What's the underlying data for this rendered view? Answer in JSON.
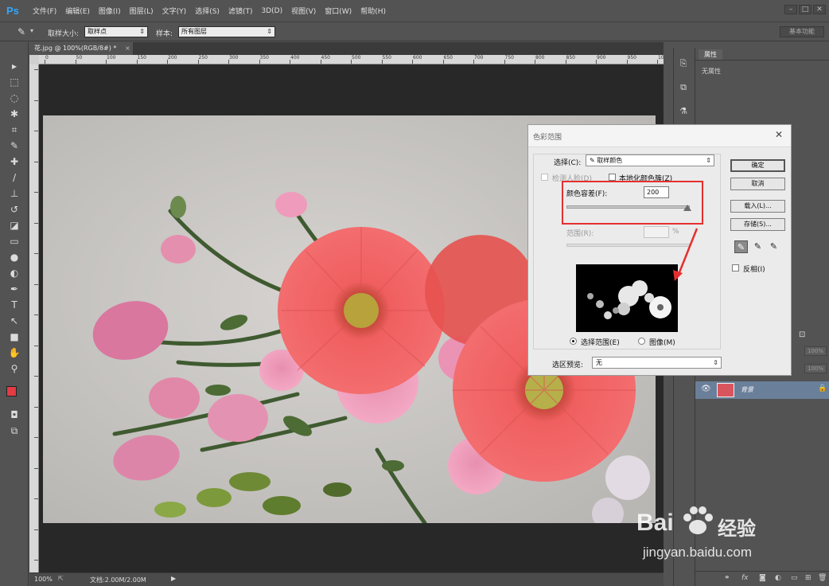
{
  "app": {
    "logo": "Ps"
  },
  "menu": [
    "文件(F)",
    "编辑(E)",
    "图像(I)",
    "图层(L)",
    "文字(Y)",
    "选择(S)",
    "滤镜(T)",
    "3D(D)",
    "视图(V)",
    "窗口(W)",
    "帮助(H)"
  ],
  "options_bar": {
    "sample_size_label": "取样大小:",
    "sample_size_value": "取样点",
    "sample_label": "样本:",
    "sample_value": "所有图层",
    "workspace": "基本功能"
  },
  "document": {
    "tab_title": "花.jpg @ 100%(RGB/8#) *",
    "ruler_ticks": [
      "0",
      "50",
      "100",
      "150",
      "200",
      "250",
      "300",
      "350",
      "400",
      "450",
      "500",
      "550",
      "600",
      "650",
      "700",
      "750",
      "800",
      "850",
      "900",
      "950",
      "1000"
    ]
  },
  "status": {
    "zoom": "100%",
    "doc_info": "文档:2.00M/2.00M"
  },
  "colors": {
    "foreground": "#e53b44",
    "background": "#ffffff",
    "accent_red": "#e52f2f",
    "selected_layer": "#6a7f9a"
  },
  "properties_panel": {
    "tab": "属性",
    "body": "无属性"
  },
  "layers_panel": {
    "opacity_value": "100%",
    "fill_value": "100%",
    "layer_name": "背景"
  },
  "dialog": {
    "title": "色彩范围",
    "select_label": "选择(C):",
    "select_value": "取样颜色",
    "detect_faces_label": "检测人脸(D)",
    "localized_label": "本地化颜色簇(Z)",
    "fuzziness_label": "颜色容差(F):",
    "fuzziness_value": "200",
    "fuzziness_level": 1.0,
    "range_label": "范围(R):",
    "range_unit": "%",
    "radio_selection": "选择范围(E)",
    "radio_image": "图像(M)",
    "selection_preview_label": "选区预览:",
    "selection_preview_value": "无",
    "buttons": {
      "ok": "确定",
      "cancel": "取消",
      "load": "载入(L)...",
      "save": "存储(S)..."
    },
    "invert_label": "反相(I)"
  },
  "watermark": {
    "brand": "Bai",
    "brand_cn": "经验",
    "url": "jingyan.baidu.com"
  }
}
